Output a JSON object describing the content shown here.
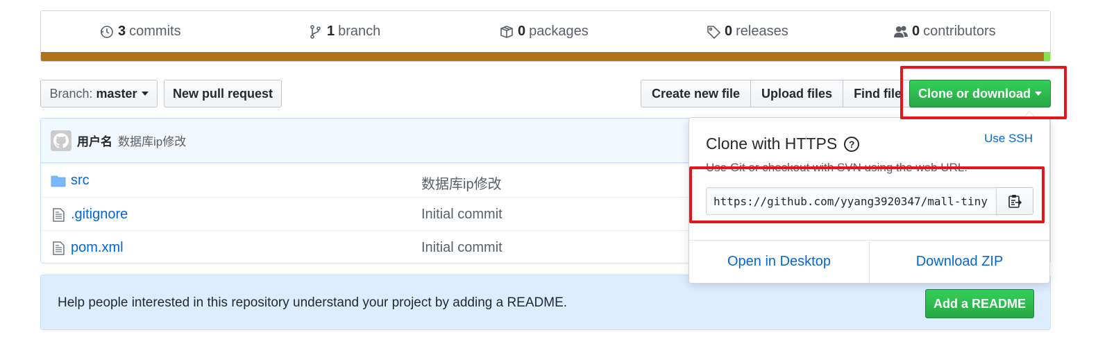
{
  "summary": {
    "commits": {
      "count": "3",
      "label": "commits"
    },
    "branches": {
      "count": "1",
      "label": "branch"
    },
    "packages": {
      "count": "0",
      "label": "packages"
    },
    "releases": {
      "count": "0",
      "label": "releases"
    },
    "contributors": {
      "count": "0",
      "label": "contributors"
    },
    "language_colors": {
      "primary": "#b07219",
      "secondary": "#89e051"
    }
  },
  "toolbar": {
    "branch_prefix": "Branch:",
    "branch_name": "master",
    "new_pull_request": "New pull request",
    "create_new_file": "Create new file",
    "upload_files": "Upload files",
    "find_file": "Find file",
    "clone_or_download": "Clone or download"
  },
  "latest_commit": {
    "author": "用户名",
    "message": "数据库ip修改"
  },
  "files": [
    {
      "name": "src",
      "type": "folder",
      "message": "数据库ip修改"
    },
    {
      "name": ".gitignore",
      "type": "file",
      "message": "Initial commit"
    },
    {
      "name": "pom.xml",
      "type": "file",
      "message": "Initial commit"
    }
  ],
  "readme": {
    "text": "Help people interested in this repository understand your project by adding a README.",
    "button": "Add a README"
  },
  "clone_dropdown": {
    "title": "Clone with HTTPS",
    "help_glyph": "?",
    "use_ssh": "Use SSH",
    "description": "Use Git or checkout with SVN using the web URL.",
    "url": "https://github.com/yyang3920347/mall-tiny",
    "open_desktop": "Open in Desktop",
    "download_zip": "Download ZIP"
  },
  "colors": {
    "primary_green": "#28a745",
    "link_blue": "#0366d6",
    "highlight_red": "#e8141c"
  }
}
